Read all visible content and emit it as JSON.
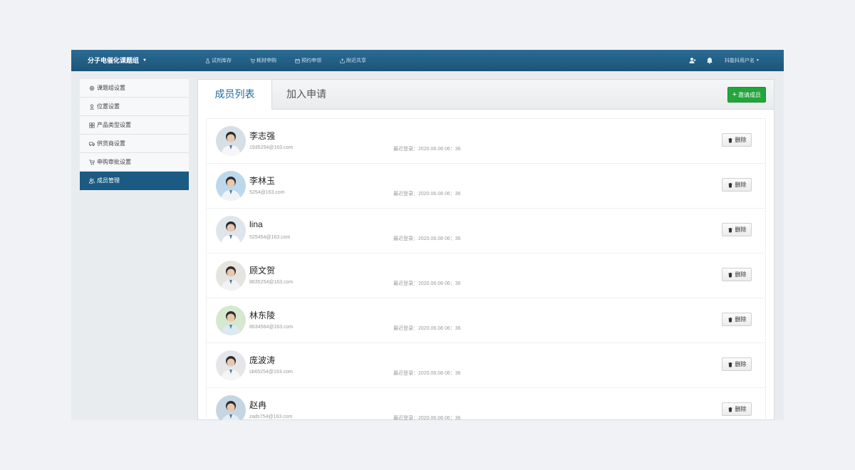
{
  "topbar": {
    "brand": "分子电催化课题组",
    "nav": [
      {
        "label": "试剂库存",
        "icon": "flask-icon"
      },
      {
        "label": "耗材申购",
        "icon": "cart-icon"
      },
      {
        "label": "预约申领",
        "icon": "calendar-icon"
      },
      {
        "label": "附近共享",
        "icon": "share-icon"
      }
    ],
    "username": "抖能抖用户名"
  },
  "sidebar": {
    "items": [
      {
        "label": "课题组设置",
        "icon": "gear-icon"
      },
      {
        "label": "位置设置",
        "icon": "location-icon"
      },
      {
        "label": "产品类型设置",
        "icon": "grid-icon"
      },
      {
        "label": "供货商设置",
        "icon": "truck-icon"
      },
      {
        "label": "申购审批设置",
        "icon": "cart-icon"
      },
      {
        "label": "成员管理",
        "icon": "users-icon"
      }
    ]
  },
  "panel": {
    "tab_active": "成员列表",
    "tab_inactive": "加入申请",
    "invite_label": "邀请成员",
    "delete_label": "删除",
    "members": [
      {
        "name": "李志强",
        "email": "1935254@163.com",
        "last_login": "最近登录：2020.06.08  06：36"
      },
      {
        "name": "李林玉",
        "email": "5254@163.com",
        "last_login": "最近登录：2020.06.08  06：36"
      },
      {
        "name": "lina",
        "email": "525454@163.com",
        "last_login": "最近登录：2020.06.08  06：36"
      },
      {
        "name": "顾文贺",
        "email": "8635254@163.com",
        "last_login": "最近登录：2020.06.08  06：36"
      },
      {
        "name": "林东陵",
        "email": "8634564@163.com",
        "last_login": "最近登录：2020.06.08  06：36"
      },
      {
        "name": "庞波涛",
        "email": "sb65254@163.com",
        "last_login": "最近登录：2020.06.08  06：36"
      },
      {
        "name": "赵冉",
        "email": "zads754@163.com",
        "last_login": "最近登录：2020.06.08  06：36"
      }
    ]
  },
  "colors": {
    "topbar": "#1c5478",
    "sidebar_active": "#1b5a82",
    "tab_active_text": "#1e6a9a",
    "invite_button": "#22a53b"
  }
}
